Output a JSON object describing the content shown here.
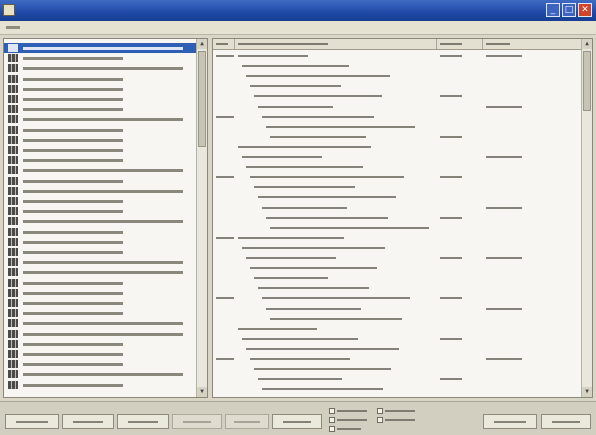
{
  "window": {
    "title": "",
    "controls": {
      "minimize": "_",
      "maximize": "□",
      "close": "✕"
    },
    "titlebar_color": "#2452ad"
  },
  "menu": {
    "items": [
      {
        "label": ""
      }
    ]
  },
  "tree": {
    "selected_index": 0,
    "rows": [
      {
        "label": ""
      },
      {
        "label": ""
      },
      {
        "label": ""
      },
      {
        "label": ""
      },
      {
        "label": ""
      },
      {
        "label": ""
      },
      {
        "label": ""
      },
      {
        "label": ""
      },
      {
        "label": ""
      },
      {
        "label": ""
      },
      {
        "label": ""
      },
      {
        "label": ""
      },
      {
        "label": ""
      },
      {
        "label": ""
      },
      {
        "label": ""
      },
      {
        "label": ""
      },
      {
        "label": ""
      },
      {
        "label": ""
      },
      {
        "label": ""
      },
      {
        "label": ""
      },
      {
        "label": ""
      },
      {
        "label": ""
      },
      {
        "label": ""
      },
      {
        "label": ""
      },
      {
        "label": ""
      },
      {
        "label": ""
      },
      {
        "label": ""
      },
      {
        "label": ""
      },
      {
        "label": ""
      },
      {
        "label": ""
      },
      {
        "label": ""
      },
      {
        "label": ""
      },
      {
        "label": ""
      },
      {
        "label": ""
      }
    ],
    "selected_color": "#2f5fb4"
  },
  "grid": {
    "columns": [
      {
        "label": ""
      },
      {
        "label": ""
      },
      {
        "label": ""
      },
      {
        "label": ""
      }
    ],
    "rows": [
      [
        "",
        "",
        "",
        ""
      ],
      [
        "",
        "",
        "",
        ""
      ],
      [
        "",
        "",
        "",
        ""
      ],
      [
        "",
        "",
        "",
        ""
      ],
      [
        "",
        "",
        "",
        ""
      ],
      [
        "",
        "",
        "",
        ""
      ],
      [
        "",
        "",
        "",
        ""
      ],
      [
        "",
        "",
        "",
        ""
      ],
      [
        "",
        "",
        "",
        ""
      ],
      [
        "",
        "",
        "",
        ""
      ],
      [
        "",
        "",
        "",
        ""
      ],
      [
        "",
        "",
        "",
        ""
      ],
      [
        "",
        "",
        "",
        ""
      ],
      [
        "",
        "",
        "",
        ""
      ],
      [
        "",
        "",
        "",
        ""
      ],
      [
        "",
        "",
        "",
        ""
      ],
      [
        "",
        "",
        "",
        ""
      ],
      [
        "",
        "",
        "",
        ""
      ],
      [
        "",
        "",
        "",
        ""
      ],
      [
        "",
        "",
        "",
        ""
      ],
      [
        "",
        "",
        "",
        ""
      ],
      [
        "",
        "",
        "",
        ""
      ],
      [
        "",
        "",
        "",
        ""
      ],
      [
        "",
        "",
        "",
        ""
      ],
      [
        "",
        "",
        "",
        ""
      ],
      [
        "",
        "",
        "",
        ""
      ],
      [
        "",
        "",
        "",
        ""
      ],
      [
        "",
        "",
        "",
        ""
      ],
      [
        "",
        "",
        "",
        ""
      ],
      [
        "",
        "",
        "",
        ""
      ],
      [
        "",
        "",
        "",
        ""
      ],
      [
        "",
        "",
        "",
        ""
      ],
      [
        "",
        "",
        "",
        ""
      ],
      [
        "",
        "",
        "",
        ""
      ]
    ]
  },
  "toolbar": {
    "buttons": [
      {
        "label": ""
      },
      {
        "label": ""
      },
      {
        "label": ""
      },
      {
        "label": ""
      },
      {
        "label": ""
      },
      {
        "label": ""
      },
      {
        "label": ""
      },
      {
        "label": ""
      }
    ],
    "options": [
      {
        "label": ""
      },
      {
        "label": ""
      },
      {
        "label": ""
      },
      {
        "label": ""
      },
      {
        "label": ""
      }
    ]
  }
}
